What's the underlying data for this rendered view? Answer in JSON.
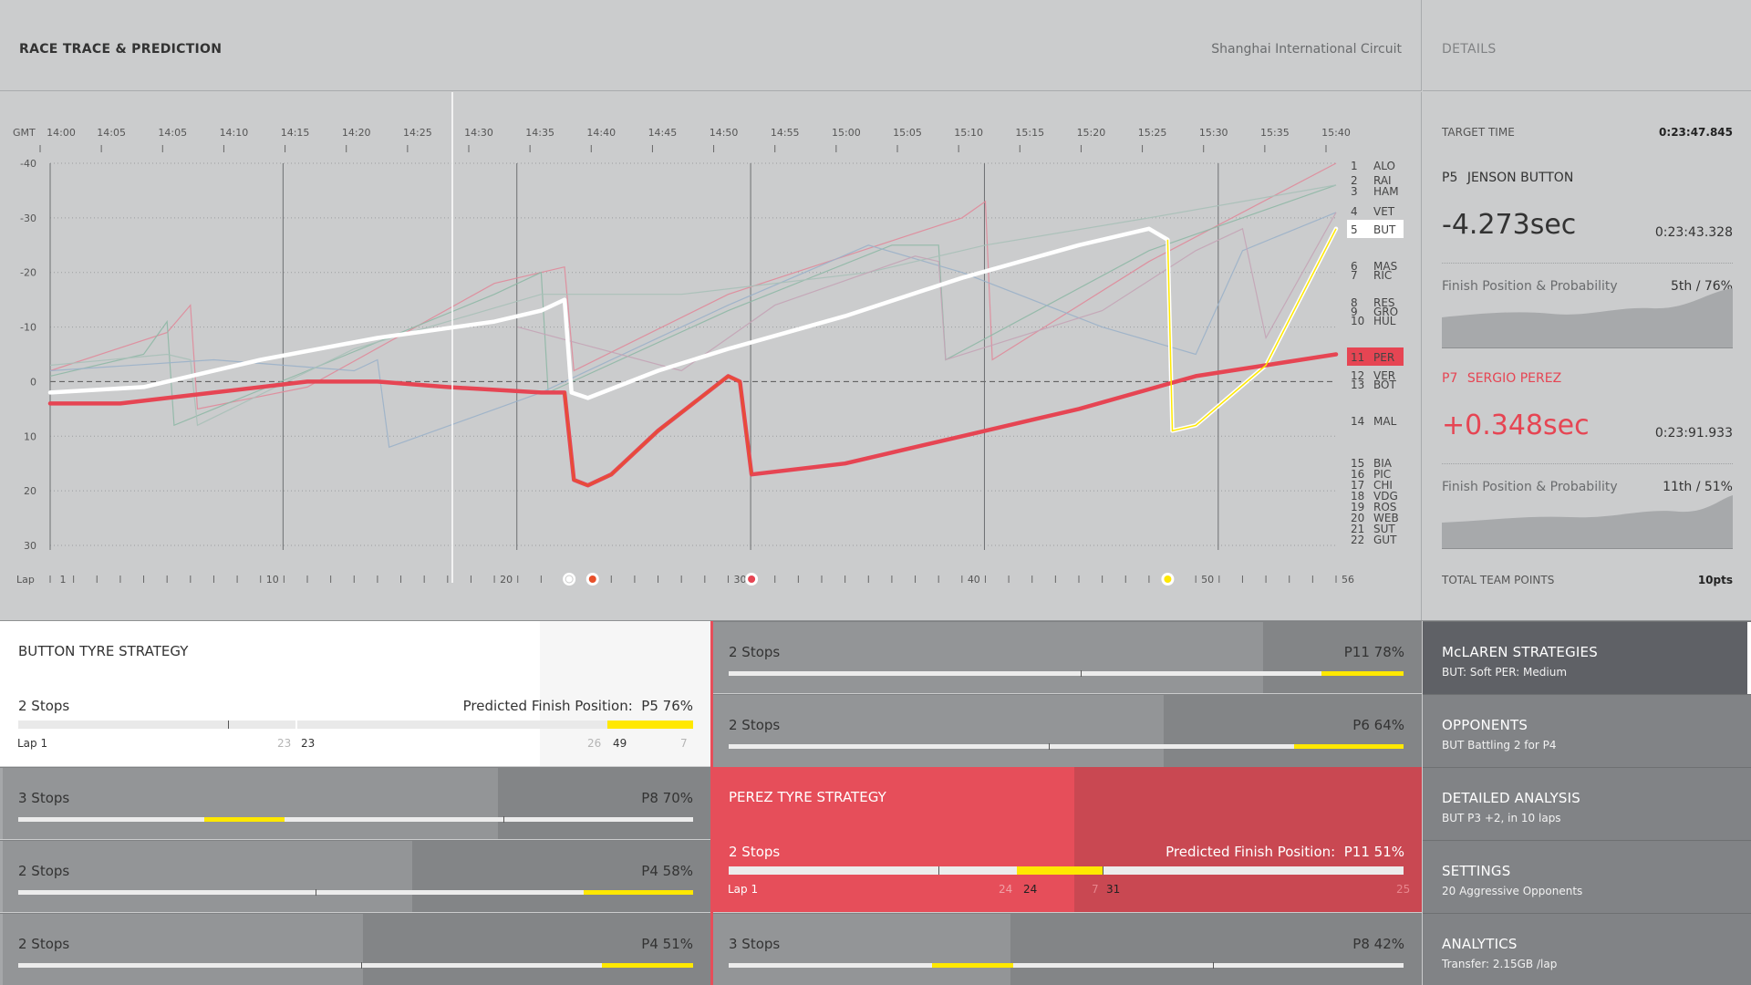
{
  "header": {
    "title": "RACE TRACE & PREDICTION",
    "circuit": "Shanghai International Circuit",
    "details_label": "DETAILS"
  },
  "chart_data": {
    "type": "line",
    "time_label": "GMT",
    "times": [
      "14:00",
      "14:05",
      "14:05",
      "14:10",
      "14:15",
      "14:20",
      "14:25",
      "14:30",
      "14:35",
      "14:40",
      "14:45",
      "14:50",
      "14:55",
      "15:00",
      "15:05",
      "15:10",
      "15:15",
      "15:20",
      "15:25",
      "15:30",
      "15:35",
      "15:40"
    ],
    "y_ticks": [
      "-40",
      "-30",
      "-20",
      "-10",
      "0",
      "10",
      "20",
      "30"
    ],
    "ylim": [
      -40,
      30
    ],
    "lap_label": "Lap",
    "lap_ticks": [
      "1",
      "10",
      "20",
      "30",
      "40",
      "50",
      "56"
    ],
    "xlim": [
      1,
      56
    ],
    "legend": [
      {
        "pos": "1",
        "code": "ALO"
      },
      {
        "pos": "2",
        "code": "RAI"
      },
      {
        "pos": "3",
        "code": "HAM"
      },
      {
        "pos": "4",
        "code": "VET"
      },
      {
        "pos": "5",
        "code": "BUT"
      },
      {
        "pos": "6",
        "code": "MAS"
      },
      {
        "pos": "7",
        "code": "RIC"
      },
      {
        "pos": "8",
        "code": "RES"
      },
      {
        "pos": "9",
        "code": "GRO"
      },
      {
        "pos": "10",
        "code": "HUL"
      },
      {
        "pos": "11",
        "code": "PER"
      },
      {
        "pos": "12",
        "code": "VER"
      },
      {
        "pos": "13",
        "code": "BOT"
      },
      {
        "pos": "14",
        "code": "MAL"
      },
      {
        "pos": "15",
        "code": "BIA"
      },
      {
        "pos": "16",
        "code": "PIC"
      },
      {
        "pos": "17",
        "code": "CHI"
      },
      {
        "pos": "18",
        "code": "VDG"
      },
      {
        "pos": "19",
        "code": "ROS"
      },
      {
        "pos": "20",
        "code": "WEB"
      },
      {
        "pos": "21",
        "code": "SUT"
      },
      {
        "pos": "22",
        "code": "GUT"
      }
    ],
    "series": [
      {
        "name": "BUT",
        "color": "#ffffff",
        "x": [
          1,
          5,
          10,
          15,
          20,
          22,
          23,
          23.3,
          24,
          27,
          30,
          35,
          40,
          45,
          48,
          48.8,
          49,
          50,
          53,
          56
        ],
        "y": [
          2,
          1,
          -4,
          -8,
          -11,
          -13,
          -15,
          2,
          3,
          -2,
          -6,
          -12,
          -19,
          -25,
          -28,
          -26,
          9,
          8,
          -3,
          -28
        ]
      },
      {
        "name": "PER",
        "color": "#e64553",
        "x": [
          1,
          4,
          8,
          12,
          15,
          18,
          22,
          23,
          23.4,
          24,
          25,
          27,
          30,
          30.5,
          31,
          35,
          40,
          45,
          50,
          56
        ],
        "y": [
          4,
          4,
          2,
          0,
          0,
          1,
          2,
          2,
          18,
          19,
          17,
          9,
          -1,
          0,
          17,
          15,
          10,
          5,
          -1,
          -5
        ]
      }
    ],
    "pit_markers": [
      {
        "lap": 23.2,
        "color": "#ffffff"
      },
      {
        "lap": 24.2,
        "color": "#e8502a"
      },
      {
        "lap": 31.0,
        "color": "#e64553"
      },
      {
        "lap": 48.8,
        "color": "#ffe800"
      }
    ]
  },
  "details": {
    "target_label": "TARGET TIME",
    "target_time": "0:23:47.845",
    "driver1": {
      "pos": "P5",
      "name": "JENSON BUTTON",
      "delta": "-4.273sec",
      "time": "0:23:43.328",
      "fp_label": "Finish Position & Probability",
      "fp_value": "5th / 76%",
      "points": "10pts"
    },
    "driver2": {
      "pos": "P7",
      "name": "SERGIO PEREZ",
      "delta": "+0.348sec",
      "time": "0:23:91.933",
      "fp_label": "Finish Position & Probability",
      "fp_value": "11th / 51%"
    },
    "team_points_label": "TOTAL TEAM POINTS",
    "team_points": "10pts"
  },
  "button_strategy": {
    "title": "BUTTON TYRE STRATEGY",
    "stops": "2 Stops",
    "predicted_label": "Predicted Finish Position:",
    "predicted_value": "P5  76%",
    "lap_start": "Lap 1",
    "m1": "23",
    "m1b": "23",
    "m2": "26",
    "m2b": "49",
    "m3": "7"
  },
  "perez_strategy": {
    "title": "PEREZ TYRE STRATEGY",
    "stops": "2 Stops",
    "predicted_label": "Predicted Finish Position:",
    "predicted_value": "P11  51%",
    "lap_start": "Lap 1",
    "m1": "24",
    "m1b": "24",
    "m2": "7",
    "m2b": "31",
    "m3": "25"
  },
  "left_alts": [
    {
      "stops": "3 Stops",
      "result": "P8  70%"
    },
    {
      "stops": "2 Stops",
      "result": "P4  58%"
    },
    {
      "stops": "2 Stops",
      "result": "P4  51%"
    }
  ],
  "right_alts": [
    {
      "stops": "2 Stops",
      "result": "P11  78%"
    },
    {
      "stops": "2 Stops",
      "result": "P6  64%"
    },
    {
      "stops": "3 Stops",
      "result": "P8  42%"
    }
  ],
  "nav": [
    {
      "title": "McLAREN STRATEGIES",
      "sub": "BUT: Soft   PER: Medium"
    },
    {
      "title": "OPPONENTS",
      "sub": "BUT Battling 2 for P4"
    },
    {
      "title": "DETAILED ANALYSIS",
      "sub": "BUT P3 +2, in 10 laps"
    },
    {
      "title": "SETTINGS",
      "sub": "20 Aggressive Opponents"
    },
    {
      "title": "ANALYTICS",
      "sub": "Transfer: 2.15GB /lap"
    }
  ],
  "colors": {
    "bg": "#cbcccd",
    "red": "#e64553",
    "yellow": "#ffe800",
    "nav_dark": "#5f6166",
    "nav_grey": "#818386"
  }
}
